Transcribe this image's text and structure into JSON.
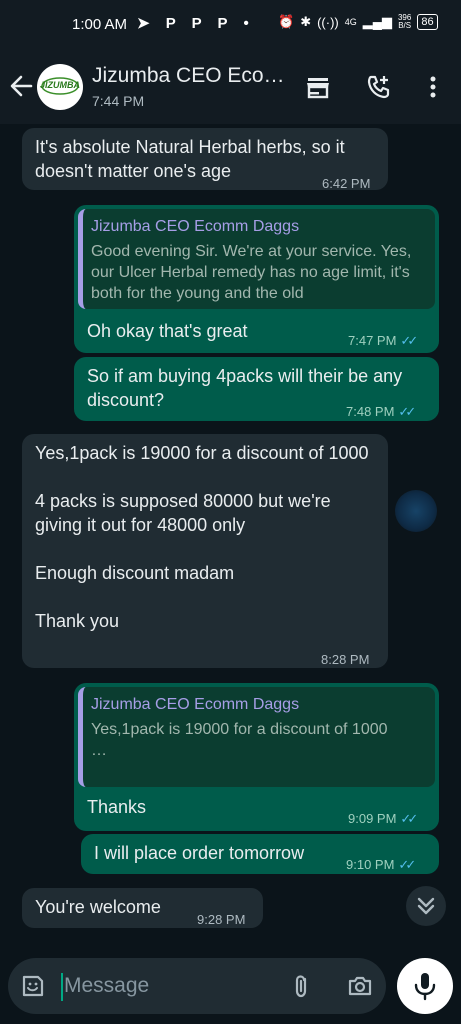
{
  "status_bar": {
    "time": "1:00 AM",
    "left_icons": "➤ P P P •",
    "network_speed_value": "396",
    "network_speed_unit": "B/S",
    "network_type": "4G",
    "battery": "86"
  },
  "header": {
    "contact_name": "Jizumba CEO Eco…",
    "last_seen": "7:44 PM",
    "avatar_text": "JIZUMBA"
  },
  "messages": [
    {
      "dir": "in",
      "text": "It's absolute Natural Herbal herbs, so it doesn't matter one's age",
      "time": "6:42 PM"
    },
    {
      "dir": "out",
      "quote_name": "Jizumba CEO Ecomm Daggs",
      "quote_text": "Good evening Sir. We're at your service. Yes, our Ulcer Herbal remedy has no age limit, it's both for the young and the old",
      "text": "Oh okay that's great",
      "time": "7:47 PM"
    },
    {
      "dir": "out",
      "text": "So if am buying 4packs will their be any discount?",
      "time": "7:48 PM"
    },
    {
      "dir": "in",
      "text": "Yes,1pack is 19000 for a discount of 1000\n\n4 packs is supposed 80000 but we're giving it out for 48000 only\n\nEnough discount madam\n\nThank you",
      "time": "8:28 PM"
    },
    {
      "dir": "out",
      "quote_name": "Jizumba CEO Ecomm Daggs",
      "quote_text": "Yes,1pack is 19000 for a discount of 1000\n…",
      "text": "Thanks",
      "time": "9:09 PM"
    },
    {
      "dir": "out",
      "text": "I will place order tomorrow",
      "time": "9:10 PM"
    },
    {
      "dir": "in",
      "text": "You're welcome",
      "time": "9:28 PM"
    }
  ],
  "input": {
    "placeholder": "Message"
  },
  "colors": {
    "background": "#0b141a",
    "incoming": "#202c33",
    "outgoing": "#005c4b",
    "read_ticks": "#53bdeb",
    "quote_bar": "#a69ee6"
  },
  "icons": [
    "back-arrow-icon",
    "store-icon",
    "add-call-icon",
    "more-vert-icon",
    "sticker-icon",
    "attach-icon",
    "camera-icon",
    "mic-icon",
    "double-chevron-down-icon"
  ]
}
